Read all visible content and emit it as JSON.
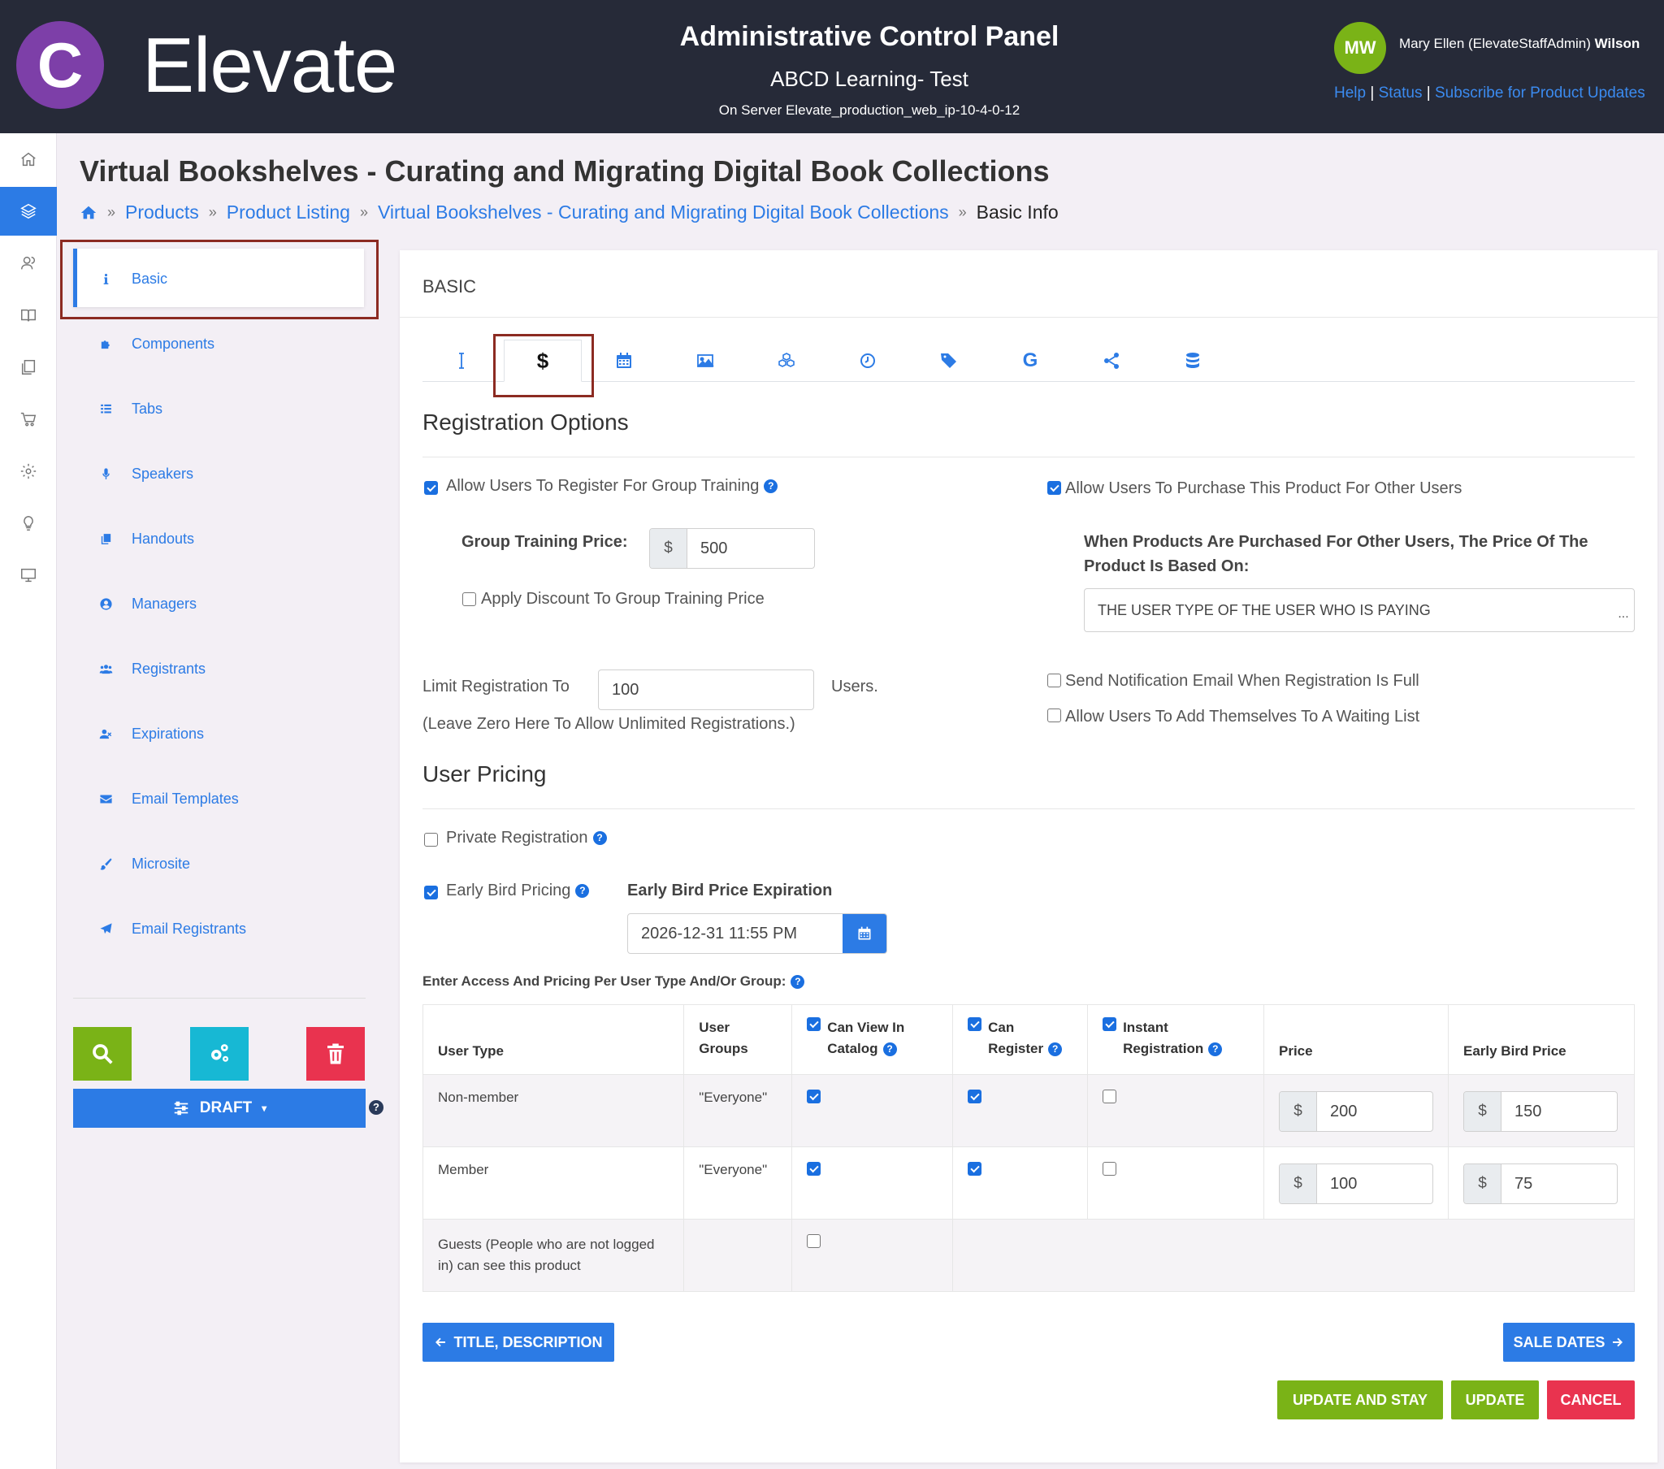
{
  "header": {
    "logo_letter": "C",
    "logo_text": "Elevate",
    "title": "Administrative Control Panel",
    "org": "ABCD Learning- Test",
    "server": "On Server Elevate_production_web_ip-10-4-0-12",
    "avatar_initials": "MW",
    "user_name_prefix": "Mary Ellen (ElevateStaffAdmin)",
    "user_name_last": "Wilson",
    "links": [
      "Help",
      "Status",
      "Subscribe for Product Updates"
    ],
    "link_separator": "|"
  },
  "rail": {
    "items": [
      "home-icon",
      "layers-icon",
      "users-icon",
      "book-icon",
      "files-icon",
      "cart-icon",
      "gear-icon",
      "lightbulb-icon",
      "monitor-icon"
    ],
    "active_index": 1
  },
  "page": {
    "title": "Virtual Bookshelves - Curating and Migrating Digital Book Collections",
    "breadcrumb": [
      "Products",
      "Product Listing",
      "Virtual Bookshelves - Curating and Migrating Digital Book Collections"
    ],
    "breadcrumb_current": "Basic Info",
    "breadcrumb_sep": "»"
  },
  "submenu": {
    "items": [
      {
        "label": "Basic",
        "icon": "info-icon"
      },
      {
        "label": "Components",
        "icon": "puzzle-icon"
      },
      {
        "label": "Tabs",
        "icon": "list-icon"
      },
      {
        "label": "Speakers",
        "icon": "microphone-icon"
      },
      {
        "label": "Handouts",
        "icon": "copy-icon"
      },
      {
        "label": "Managers",
        "icon": "user-circle-icon"
      },
      {
        "label": "Registrants",
        "icon": "users-icon"
      },
      {
        "label": "Expirations",
        "icon": "user-times-icon"
      },
      {
        "label": "Email Templates",
        "icon": "envelope-icon"
      },
      {
        "label": "Microsite",
        "icon": "brush-icon"
      },
      {
        "label": "Email Registrants",
        "icon": "paper-plane-icon"
      }
    ],
    "active": "Basic",
    "draft_label": "DRAFT",
    "help_glyph": "?",
    "colors": {
      "search": "#7ab317",
      "settings": "#17b8d4",
      "delete": "#e9334f"
    }
  },
  "card": {
    "title": "BASIC",
    "tabs": [
      "text-cursor-icon",
      "dollar-icon",
      "calendar-icon",
      "image-icon",
      "cubes-icon",
      "clock-icon",
      "tags-icon",
      "google-icon",
      "share-icon",
      "database-icon"
    ],
    "active_tab": 1
  },
  "registration": {
    "heading": "Registration Options",
    "allow_group": {
      "label": "Allow Users To Register For Group Training",
      "checked": true
    },
    "group_price_label": "Group Training Price:",
    "currency": "$",
    "group_price": "500",
    "apply_discount": {
      "label": "Apply Discount To Group Training Price",
      "checked": false
    },
    "limit_label": "Limit Registration To",
    "limit_value": "100",
    "limit_suffix": "Users.",
    "limit_note": "(Leave Zero Here To Allow Unlimited Registrations.)",
    "allow_purchase_others": {
      "label": "Allow Users To Purchase This Product For Other Users",
      "checked": true
    },
    "price_basis_label": "When Products Are Purchased For Other Users, The Price Of The Product Is Based On:",
    "price_basis_value": "THE USER TYPE OF THE USER WHO IS PAYING",
    "price_basis_more": "...",
    "send_notification": {
      "label": "Send Notification Email When Registration Is Full",
      "checked": false
    },
    "waiting_list": {
      "label": "Allow Users To Add Themselves To A Waiting List",
      "checked": false
    }
  },
  "pricing": {
    "heading": "User Pricing",
    "private": {
      "label": "Private Registration",
      "checked": false
    },
    "early_bird": {
      "label": "Early Bird Pricing",
      "checked": true
    },
    "early_bird_exp_label": "Early Bird Price Expiration",
    "early_bird_exp_value": "2026-12-31 11:55 PM",
    "table_caption": "Enter Access And Pricing Per User Type And/Or Group:",
    "columns": {
      "user_type": "User Type",
      "user_groups": "User Groups",
      "can_view": "Can View In Catalog",
      "can_register": "Can Register",
      "instant": "Instant Registration",
      "price": "Price",
      "early_bird_price": "Early Bird Price"
    },
    "header_checks": {
      "can_view": true,
      "can_register": true,
      "instant": true
    },
    "rows": [
      {
        "user_type": "Non-member",
        "groups": "\"Everyone\"",
        "can_view": true,
        "can_register": true,
        "instant": false,
        "price": "200",
        "early": "150"
      },
      {
        "user_type": "Member",
        "groups": "\"Everyone\"",
        "can_view": true,
        "can_register": true,
        "instant": false,
        "price": "100",
        "early": "75"
      }
    ],
    "guest_row": {
      "label": "Guests (People who are not logged in) can see this product",
      "checked": false
    }
  },
  "buttons": {
    "prev": "TITLE, DESCRIPTION",
    "next": "SALE DATES",
    "update_stay": "UPDATE AND STAY",
    "update": "UPDATE",
    "cancel": "CANCEL"
  }
}
